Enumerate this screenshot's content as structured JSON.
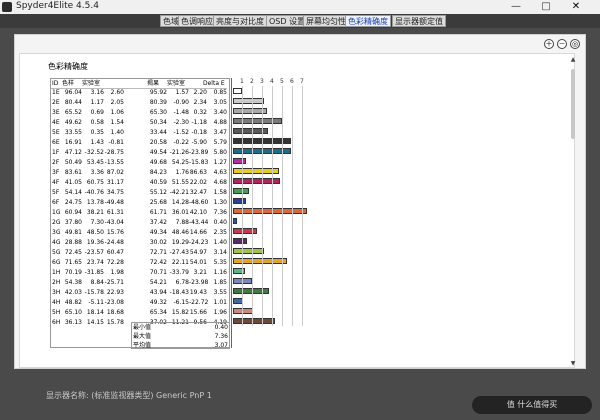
{
  "app": {
    "title": "Spyder4Elite 4.5.4",
    "win_buttons": [
      "—",
      "□",
      "✕"
    ]
  },
  "tabs": [
    {
      "label": "色域",
      "active": false
    },
    {
      "label": "色调响应",
      "active": false
    },
    {
      "label": "亮度与对比度",
      "active": false
    },
    {
      "label": "OSD 设置",
      "active": false
    },
    {
      "label": "屏幕均匀性",
      "active": false
    },
    {
      "label": "色彩精确度",
      "active": true
    },
    {
      "label": "显示器额定值",
      "active": false
    }
  ],
  "report": {
    "title": "色彩精确度",
    "headers": {
      "id": "ID",
      "col1": "色样",
      "col2": "实验室",
      "col3": "",
      "col4": "",
      "col5": "揭果",
      "col6": "实验室",
      "col7": "",
      "col8": "",
      "delta": "Delta E"
    },
    "ticks": [
      "1",
      "2",
      "3",
      "4",
      "5",
      "6",
      "7"
    ],
    "rows": [
      {
        "id": "1E",
        "v": [
          "96.04",
          "3.16",
          "2.60",
          "95.92",
          "1.57",
          "2.20"
        ],
        "d": "0.85",
        "color": "#ffffff"
      },
      {
        "id": "2E",
        "v": [
          "80.44",
          "1.17",
          "2.05",
          "80.39",
          "-0.90",
          "2.34",
          "3.05"
        ],
        "d": "3.05",
        "color": "#c9c9c9"
      },
      {
        "id": "3E",
        "v": [
          "65.52",
          "0.69",
          "1.06",
          "65.30",
          "-1.48",
          "0.32"
        ],
        "d": "3.40",
        "color": "#a8a8a8"
      },
      {
        "id": "4E",
        "v": [
          "49.62",
          "0.58",
          "1.54",
          "50.34",
          "-2.30",
          "-1.18"
        ],
        "d": "4.88",
        "color": "#7a7a7a"
      },
      {
        "id": "5E",
        "v": [
          "33.55",
          "0.35",
          "1.40",
          "33.44",
          "-1.52",
          "-0.18"
        ],
        "d": "3.47",
        "color": "#5a5a5a"
      },
      {
        "id": "6E",
        "v": [
          "16.91",
          "1.43",
          "-0.81",
          "20.58",
          "-0.22",
          "-5.90"
        ],
        "d": "5.79",
        "color": "#333333"
      },
      {
        "id": "1F",
        "v": [
          "47.12",
          "-32.52",
          "-28.75",
          "49.54",
          "-21.26",
          "-23.89"
        ],
        "d": "5.80",
        "color": "#1e6b86"
      },
      {
        "id": "2F",
        "v": [
          "50.49",
          "53.45",
          "-13.55",
          "49.68",
          "54.25",
          "-15.83"
        ],
        "d": "1.27",
        "color": "#b82ca0"
      },
      {
        "id": "3F",
        "v": [
          "83.61",
          "3.36",
          "87.02",
          "84.23",
          "1.76",
          "86.63"
        ],
        "d": "4.63",
        "color": "#e6cc1c"
      },
      {
        "id": "4F",
        "v": [
          "41.05",
          "60.75",
          "31.17",
          "40.59",
          "51.55",
          "22.02"
        ],
        "d": "4.68",
        "color": "#b2245a"
      },
      {
        "id": "5F",
        "v": [
          "54.14",
          "-40.76",
          "34.75",
          "55.12",
          "-42.21",
          "32.47"
        ],
        "d": "1.58",
        "color": "#3fa14e"
      },
      {
        "id": "6F",
        "v": [
          "24.75",
          "13.78",
          "-49.48",
          "25.68",
          "14.28",
          "-48.60"
        ],
        "d": "1.30",
        "color": "#2a3fa0"
      },
      {
        "id": "1G",
        "v": [
          "60.94",
          "38.21",
          "61.31",
          "61.71",
          "36.01",
          "42.10"
        ],
        "d": "7.36",
        "color": "#d9683a"
      },
      {
        "id": "2G",
        "v": [
          "37.80",
          "7.30",
          "-43.04",
          "37.42",
          "7.88",
          "-43.44"
        ],
        "d": "0.40",
        "color": "#3a4fa0"
      },
      {
        "id": "3G",
        "v": [
          "49.81",
          "48.50",
          "15.76",
          "49.34",
          "48.46",
          "14.66"
        ],
        "d": "2.35",
        "color": "#c33a4f"
      },
      {
        "id": "4G",
        "v": [
          "28.88",
          "19.36",
          "-24.48",
          "30.02",
          "19.29",
          "-24.23"
        ],
        "d": "1.40",
        "color": "#5a2a66"
      },
      {
        "id": "5G",
        "v": [
          "72.45",
          "-23.57",
          "60.47",
          "72.71",
          "-27.43",
          "54.97"
        ],
        "d": "3.14",
        "color": "#9fc440"
      },
      {
        "id": "6G",
        "v": [
          "71.65",
          "23.74",
          "72.28",
          "72.42",
          "22.11",
          "54.01"
        ],
        "d": "5.35",
        "color": "#e3a529"
      },
      {
        "id": "1H",
        "v": [
          "70.19",
          "-31.85",
          "1.98",
          "70.71",
          "-33.79",
          "3.21"
        ],
        "d": "1.16",
        "color": "#58b68f"
      },
      {
        "id": "2H",
        "v": [
          "54.38",
          "8.84",
          "-25.71",
          "54.21",
          "6.78",
          "-23.98"
        ],
        "d": "1.85",
        "color": "#7a86bf"
      },
      {
        "id": "3H",
        "v": [
          "42.03",
          "-15.78",
          "22.93",
          "43.94",
          "-18.43",
          "19.43"
        ],
        "d": "3.55",
        "color": "#3f7a3e"
      },
      {
        "id": "4H",
        "v": [
          "48.82",
          "-5.11",
          "-23.08",
          "49.32",
          "-6.15",
          "-22.72"
        ],
        "d": "1.01",
        "color": "#3f6aa0"
      },
      {
        "id": "5H",
        "v": [
          "65.10",
          "18.14",
          "18.68",
          "65.34",
          "15.82",
          "15.66"
        ],
        "d": "1.96",
        "color": "#c98a7a"
      },
      {
        "id": "6H",
        "v": [
          "36.13",
          "14.15",
          "15.78",
          "37.02",
          "11.21",
          "9.56"
        ],
        "d": "4.19",
        "color": "#6b4a3a"
      }
    ],
    "summary": {
      "min_label": "最小值",
      "min_value": "0.40",
      "max_label": "最大值",
      "max_value": "7.36",
      "avg_label": "平均值",
      "avg_value": "3.07"
    }
  },
  "footer": {
    "text": "显示器名称: (标准监视器类型) Generic PnP 1",
    "corner": "值 什么值得买"
  }
}
